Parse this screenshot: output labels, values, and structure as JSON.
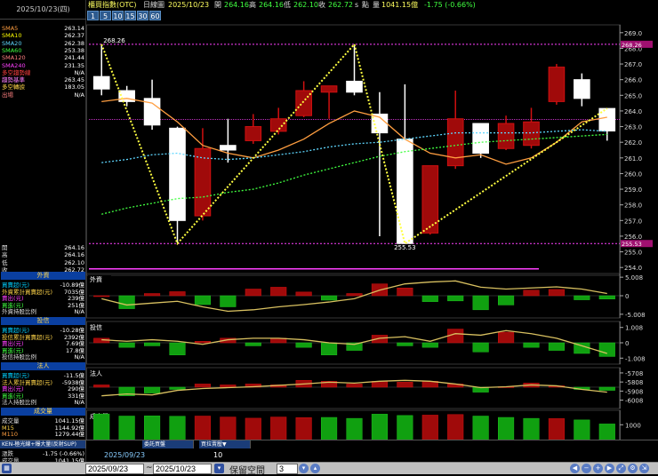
{
  "left_panel": {
    "date": "2025/10/23(四)",
    "ma_rows": [
      {
        "label": "SMA5",
        "value": "263.14",
        "color": "#ff9e40"
      },
      {
        "label": "SMA10",
        "value": "262.37",
        "color": "#ffff00"
      },
      {
        "label": "SMA20",
        "value": "262.38",
        "color": "#5fd7ff"
      },
      {
        "label": "SMA60",
        "value": "253.38",
        "color": "#40ff40"
      },
      {
        "label": "SMA120",
        "value": "241.44",
        "color": "#ff8080"
      },
      {
        "label": "SMA240",
        "value": "231.35",
        "color": "#ff40ff"
      },
      {
        "label": "多空趨勢線",
        "value": "N/A",
        "color": "#ff4040"
      },
      {
        "label": "趨勢基準",
        "value": "263.45",
        "color": "#ff80ff"
      },
      {
        "label": "多空轉捩",
        "value": "183.05",
        "color": "#ffd54a"
      },
      {
        "label": "出場",
        "value": "N/A",
        "color": "#ff8080"
      }
    ],
    "ohlc": [
      {
        "label": "開",
        "value": "264.16"
      },
      {
        "label": "高",
        "value": "264.16"
      },
      {
        "label": "低",
        "value": "262.10"
      },
      {
        "label": "收",
        "value": "262.72"
      }
    ],
    "sections": [
      {
        "title": "外資",
        "rows": [
          {
            "label": "買賣超(元)",
            "value": "-10.89億",
            "color": "#00d0ff"
          },
          {
            "label": "外資累計買賣超(元)",
            "value": "7035億",
            "color": "#ffd54a"
          },
          {
            "label": "賣出(元)",
            "value": "239億",
            "color": "#ff40ff"
          },
          {
            "label": "買進(元)",
            "value": "251億",
            "color": "#40ff40"
          },
          {
            "label": "外資持股比例",
            "value": "N/A",
            "color": "#ddd"
          }
        ]
      },
      {
        "title": "投信",
        "rows": [
          {
            "label": "買賣超(元)",
            "value": "-10.28億",
            "color": "#00d0ff"
          },
          {
            "label": "投信累計買賣超(元)",
            "value": "2392億",
            "color": "#ffd54a"
          },
          {
            "label": "賣出(元)",
            "value": "7.69億",
            "color": "#ff40ff"
          },
          {
            "label": "買進(元)",
            "value": "17.8億",
            "color": "#40ff40"
          },
          {
            "label": "投信持股比例",
            "value": "N/A",
            "color": "#ddd"
          }
        ]
      },
      {
        "title": "法人",
        "rows": [
          {
            "label": "買賣超(元)",
            "value": "-11.5億",
            "color": "#00d0ff"
          },
          {
            "label": "法人累計買賣超(元)",
            "value": "-5938億",
            "color": "#ffd54a"
          },
          {
            "label": "賣出(元)",
            "value": "290億",
            "color": "#ff40ff"
          },
          {
            "label": "買進(元)",
            "value": "331億",
            "color": "#40ff40"
          },
          {
            "label": "法人持股比例",
            "value": "N/A",
            "color": "#ddd"
          }
        ]
      },
      {
        "title": "成交量",
        "rows": [
          {
            "label": "成交量",
            "value": "1041.15億",
            "color": "#ddd"
          },
          {
            "label": "M15",
            "value": "1144.92億",
            "color": "#ffd54a"
          },
          {
            "label": "M110",
            "value": "1279.44億",
            "color": "#ff9e40"
          }
        ]
      }
    ],
    "bottom_rows": [
      {
        "label": "漲跌",
        "value": "-1.75 (-0.66%)"
      },
      {
        "label": "成交量",
        "value": "1041.15億"
      }
    ]
  },
  "topbar": {
    "title": "櫃買指數(OTC)",
    "period_label": "日線圖",
    "date": "2025/10/23",
    "open_label": "開",
    "open": "264.16",
    "high_label": "高",
    "high": "264.16",
    "low_label": "低",
    "low": "262.10",
    "close_label": "收",
    "close": "262.72",
    "flag": "s",
    "point_label": "點",
    "vol_label": "量",
    "volume": "1041.15億",
    "change": "-1.75 (-0.66%)"
  },
  "periods": [
    "1",
    "5",
    "10",
    "15",
    "30",
    "60"
  ],
  "info_bar": [
    "KEN-極光線+爆大量(反射SUP)",
    "委託買盤",
    "買拉賣壓▼"
  ],
  "bottom_bar": {
    "date_left": "2025/09/23",
    "count": "10"
  },
  "controls": {
    "from": "2025/09/23",
    "to": "2025/10/23",
    "label": "保留空間",
    "spaces": "3"
  },
  "colors": {
    "up": "#d01010",
    "down": "#ffffff",
    "vol_up": "#c01010",
    "vol_down": "#20c020"
  },
  "chart_data": [
    {
      "type": "candlestick",
      "title": "櫃買指數(OTC)",
      "ylim": [
        253.5,
        269.5
      ],
      "yticks": [
        254,
        255,
        256,
        257,
        258,
        259,
        260,
        261,
        262,
        263,
        264,
        265,
        266,
        267,
        268,
        269
      ],
      "y_extra_labels": [
        "268.26",
        "255.53"
      ],
      "candles": [
        {
          "o": 266.2,
          "h": 268.26,
          "c": 265.4,
          "l": 265.0
        },
        {
          "o": 265.3,
          "h": 265.6,
          "c": 264.6,
          "l": 264.3
        },
        {
          "o": 264.8,
          "h": 266.0,
          "c": 263.1,
          "l": 262.8
        },
        {
          "o": 262.9,
          "h": 263.0,
          "c": 257.0,
          "l": 255.6
        },
        {
          "o": 257.3,
          "h": 262.9,
          "c": 261.6,
          "l": 257.0
        },
        {
          "o": 261.8,
          "h": 263.5,
          "c": 261.5,
          "l": 260.7
        },
        {
          "o": 262.1,
          "h": 263.8,
          "c": 263.0,
          "l": 261.9
        },
        {
          "o": 262.7,
          "h": 264.2,
          "c": 263.5,
          "l": 262.5
        },
        {
          "o": 263.7,
          "h": 265.9,
          "c": 265.3,
          "l": 263.6
        },
        {
          "o": 265.2,
          "h": 265.6,
          "c": 265.6,
          "l": 263.5
        },
        {
          "o": 265.9,
          "h": 268.26,
          "c": 265.2,
          "l": 265.0
        },
        {
          "o": 263.8,
          "h": 265.2,
          "c": 262.6,
          "l": 256.0
        },
        {
          "o": 262.2,
          "h": 265.7,
          "c": 255.53,
          "l": 255.5
        },
        {
          "o": 256.2,
          "h": 260.5,
          "c": 260.5,
          "l": 256.1
        },
        {
          "o": 260.5,
          "h": 265.3,
          "c": 263.5,
          "l": 260.3
        },
        {
          "o": 263.2,
          "h": 263.2,
          "c": 261.3,
          "l": 261.0
        },
        {
          "o": 261.6,
          "h": 263.7,
          "c": 263.2,
          "l": 261.5
        },
        {
          "o": 261.8,
          "h": 264.2,
          "c": 263.3,
          "l": 261.6
        },
        {
          "o": 264.6,
          "h": 267.0,
          "c": 266.8,
          "l": 264.4
        },
        {
          "o": 266.0,
          "h": 266.4,
          "c": 264.8,
          "l": 264.3
        },
        {
          "o": 264.16,
          "h": 264.16,
          "c": 262.72,
          "l": 262.1
        }
      ],
      "sma5": [
        264.6,
        264.8,
        264.5,
        263.3,
        261.8,
        261.3,
        261.0,
        261.5,
        262.2,
        263.2,
        264.0,
        263.6,
        262.2,
        261.3,
        261.0,
        261.2,
        260.6,
        261.0,
        262.0,
        263.3,
        263.6
      ],
      "sma20": [
        260.7,
        260.9,
        261.2,
        261.3,
        261.0,
        260.9,
        261.0,
        261.2,
        261.4,
        261.7,
        261.9,
        262.0,
        262.2,
        262.4,
        262.6,
        262.6,
        262.6,
        262.6,
        262.7,
        262.8,
        262.7
      ],
      "sma60": [
        257.4,
        257.8,
        258.1,
        258.4,
        258.5,
        258.8,
        259.0,
        259.4,
        259.9,
        260.3,
        260.7,
        261.1,
        261.4,
        261.6,
        261.8,
        262.0,
        262.1,
        262.2,
        262.3,
        262.4,
        262.5
      ],
      "trend_base": 263.45,
      "zigzag": [
        268.26,
        255.53,
        268.26,
        255.53,
        264.16
      ],
      "zigzag_idx": [
        0,
        3,
        10,
        12,
        20
      ]
    },
    {
      "type": "bar",
      "title": "外資",
      "ylim": [
        -6,
        6
      ],
      "yticks": [
        5.008,
        0,
        -5.008
      ],
      "values": [
        0,
        -3.5,
        0.6,
        1.1,
        -2.4,
        -3.0,
        1.8,
        2.3,
        1.0,
        -1.2,
        0.6,
        3.2,
        2.1,
        -1.6,
        -1.4,
        -3.8,
        -2.5,
        1.5,
        1.7,
        -1.1,
        -0.9
      ],
      "line": [
        -0.8,
        -2.5,
        -2.0,
        -1.5,
        -3.0,
        -4.2,
        -3.8,
        -3.0,
        -2.4,
        -1.7,
        -0.8,
        1.5,
        3.2,
        3.7,
        4.0,
        2.3,
        1.8,
        2.1,
        2.4,
        1.8,
        0.6
      ]
    },
    {
      "type": "bar",
      "title": "投信",
      "ylim": [
        -1.4,
        1.4
      ],
      "yticks": [
        1.008,
        0,
        -1.008
      ],
      "values": [
        0.3,
        -0.3,
        -0.2,
        -0.8,
        0.1,
        0.3,
        -0.2,
        0.3,
        -0.3,
        -0.8,
        -0.5,
        0.5,
        -0.2,
        -0.3,
        0.9,
        -0.6,
        0.7,
        -0.3,
        -0.5,
        -0.7,
        -0.9
      ],
      "line": [
        0.2,
        0.1,
        0.2,
        0.1,
        -0.1,
        0.2,
        0.3,
        0.3,
        0.2,
        0.0,
        -0.1,
        0.3,
        0.4,
        0.1,
        0.6,
        0.5,
        0.8,
        0.6,
        0.3,
        -0.2,
        -0.7
      ]
    },
    {
      "type": "bar",
      "title": "法人",
      "ylim": [
        -6100,
        -5650
      ],
      "base": -5865,
      "yticks": [
        -5708,
        -5808,
        -5908,
        -6008
      ],
      "values": [
        -5840,
        -5960,
        -5930,
        -5890,
        -5830,
        -5840,
        -5830,
        -5840,
        -5790,
        -5800,
        -5830,
        -5800,
        -5810,
        -5800,
        -5830,
        -5920,
        -5860,
        -5820,
        -5850,
        -5890,
        -5900
      ],
      "line": [
        -5960,
        -5940,
        -5950,
        -5900,
        -5880,
        -5870,
        -5860,
        -5845,
        -5830,
        -5810,
        -5820,
        -5800,
        -5790,
        -5800,
        -5830,
        -5870,
        -5860,
        -5840,
        -5850,
        -5890,
        -5920
      ]
    },
    {
      "type": "bar",
      "title": "成交量",
      "ylim": [
        0,
        1750
      ],
      "yticks": [
        1000
      ],
      "values": [
        1560,
        1450,
        1460,
        1440,
        1450,
        1400,
        1340,
        1400,
        1370,
        1380,
        1330,
        1550,
        1480,
        1500,
        1530,
        1450,
        1380,
        1330,
        1320,
        1250,
        1041.15
      ],
      "up": [
        false,
        false,
        false,
        false,
        true,
        true,
        true,
        true,
        true,
        false,
        false,
        false,
        false,
        true,
        true,
        false,
        false,
        false,
        true,
        false,
        false
      ]
    }
  ]
}
